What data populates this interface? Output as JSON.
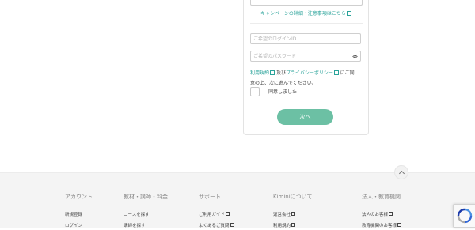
{
  "form": {
    "campaign_link": "キャンペーンの詳細・注意事項はこちら",
    "login_id_placeholder": "ご希望のログインID",
    "password_placeholder": "ご希望のパスワード",
    "terms_link": "利用規約",
    "and_text": "及び",
    "privacy_link": "プライバシーポリシー",
    "terms_rest_1": "にご同",
    "terms_rest_2": "意の上、次に進んでください。",
    "agree_label": "同意しました",
    "agree_checked": false,
    "next_button": "次へ"
  },
  "footer": {
    "columns": [
      {
        "title": "アカウント",
        "items": [
          "新規登録",
          "ログイン"
        ]
      },
      {
        "title": "教材・講師・料金",
        "items": [
          "コースを探す",
          "講師を探す"
        ]
      },
      {
        "title": "サポート",
        "items": [
          "ご利用ガイド",
          "よくあるご質問"
        ]
      },
      {
        "title": "Kiminiについて",
        "items": [
          "運営会社",
          "利用規約"
        ]
      },
      {
        "title": "法人・教育機関",
        "items": [
          "法人のお客様",
          "教育機関のお客様"
        ]
      }
    ]
  },
  "colors": {
    "accent": "#2aa39a",
    "button": "#6cc0a4",
    "footer_bg": "#f4f4f4"
  },
  "icons": {
    "scroll_top": "chevron-up-icon",
    "password_toggle": "eye-slash-icon",
    "external": "external-link-icon",
    "captcha": "recaptcha-icon"
  }
}
